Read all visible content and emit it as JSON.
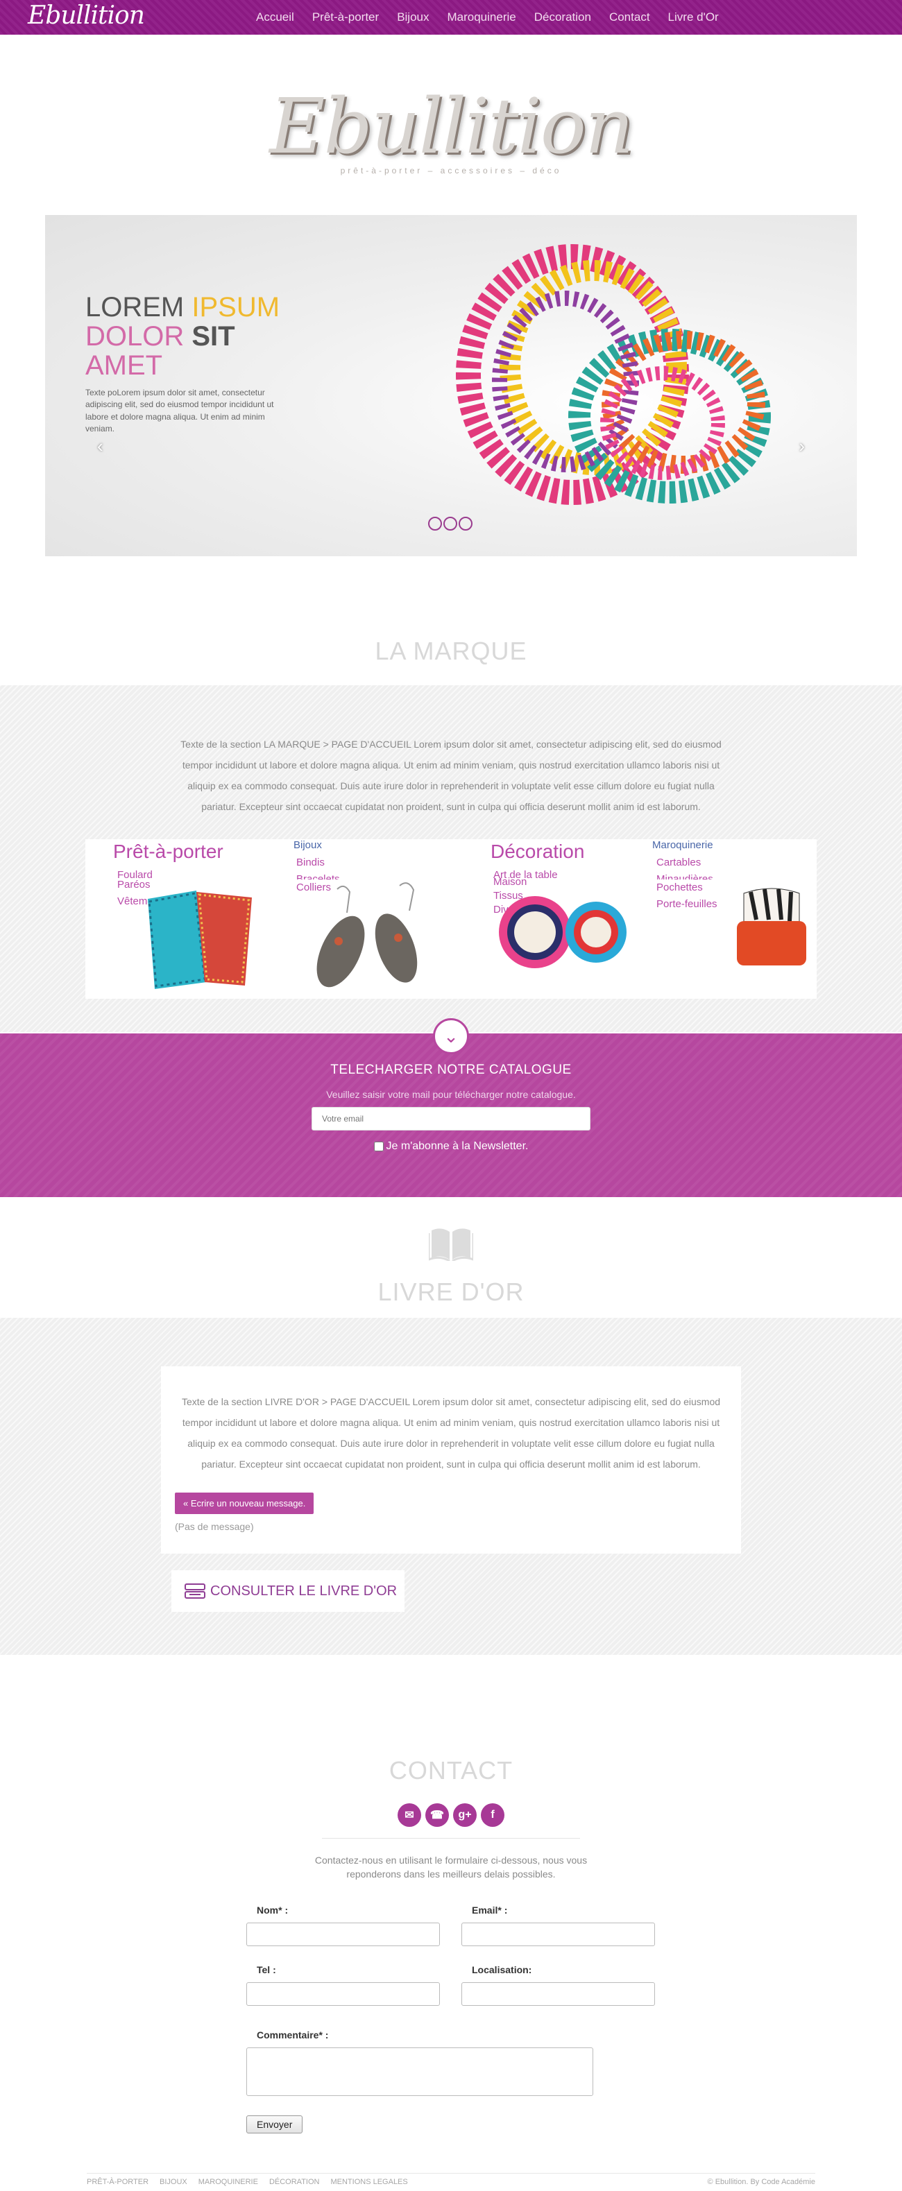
{
  "nav": {
    "logo": "Ebullition",
    "items": [
      "Accueil",
      "Prêt-à-porter",
      "Bijoux",
      "Maroquinerie",
      "Décoration",
      "Contact",
      "Livre d'Or"
    ]
  },
  "hero": {
    "logo": "Ebullition",
    "tagline": "prêt-à-porter – accessoires – déco"
  },
  "slider": {
    "line1a": "LOREM",
    "line1b": "IPSUM",
    "line2a": "DOLOR",
    "line2b": "SIT",
    "line3": "AMET",
    "text": "Texte poLorem ipsum dolor sit amet, consectetur adipiscing elit, sed do eiusmod tempor incididunt ut labore et dolore magna aliqua. Ut enim ad minim veniam.",
    "prev": "‹",
    "next": "›"
  },
  "marque": {
    "title": "LA MARQUE",
    "text": "Texte de la section LA MARQUE > PAGE D'ACCUEIL Lorem ipsum dolor sit amet, consectetur adipiscing elit, sed do eiusmod tempor incididunt ut labore et dolore magna aliqua. Ut enim ad minim veniam, quis nostrud exercitation ullamco laboris nisi ut aliquip ex ea commodo consequat. Duis aute irure dolor in reprehenderit in voluptate velit esse cillum dolore eu fugiat nulla pariatur. Excepteur sint occaecat cupidatat non proident, sunt in culpa qui officia deserunt mollit anim id est laborum.",
    "products": [
      {
        "title": "Prêt-à-porter",
        "items": [
          "Foulard",
          "Paréos",
          "Vêtements"
        ]
      },
      {
        "title": "Bijoux",
        "items": [
          "Bindis",
          "Bracelets",
          "Colliers"
        ]
      },
      {
        "title": "Décoration",
        "items": [
          "Art de la table",
          "Maison",
          "Tissus",
          "Divers"
        ]
      },
      {
        "title": "Maroquinerie",
        "items": [
          "Cartables",
          "Minaudières",
          "Pochettes",
          "Porte-feuilles"
        ]
      }
    ]
  },
  "catalogue": {
    "title": "TELECHARGER NOTRE CATALOGUE",
    "subtitle": "Veuillez saisir votre mail pour télécharger notre catalogue.",
    "email_placeholder": "Votre email",
    "newsletter": "Je m'abonne à la Newsletter."
  },
  "livre": {
    "title": "LIVRE D'OR",
    "text": "Texte de la section LIVRE D'OR > PAGE D'ACCUEIL Lorem ipsum dolor sit amet, consectetur adipiscing elit, sed do eiusmod tempor incididunt ut labore et dolore magna aliqua. Ut enim ad minim veniam, quis nostrud exercitation ullamco laboris nisi ut aliquip ex ea commodo consequat. Duis aute irure dolor in reprehenderit in voluptate velit esse cillum dolore eu fugiat nulla pariatur. Excepteur sint occaecat cupidatat non proident, sunt in culpa qui officia deserunt mollit anim id est laborum.",
    "write_button": "« Ecrire un nouveau message.",
    "no_message": "(Pas de message)",
    "consult": "CONSULTER LE LIVRE D'OR"
  },
  "contact": {
    "title": "CONTACT",
    "intro": "Contactez-nous en utilisant le formulaire ci-dessous, nous vous reponderons dans les meilleurs delais possibles.",
    "fields": {
      "nom": "Nom* :",
      "email": "Email* :",
      "tel": "Tel :",
      "localisation": "Localisation:",
      "commentaire": "Commentaire* :"
    },
    "submit": "Envoyer"
  },
  "footer": {
    "links": [
      "PRÊT-À-PORTER",
      "BIJOUX",
      "MAROQUINERIE",
      "DÉCORATION",
      "MENTIONS LEGALES"
    ],
    "credit": "© Ebullition. By Code Académie"
  },
  "colors": {
    "brand": "#8f1a86",
    "accent": "#b6479f",
    "gold": "#f0b92f"
  }
}
